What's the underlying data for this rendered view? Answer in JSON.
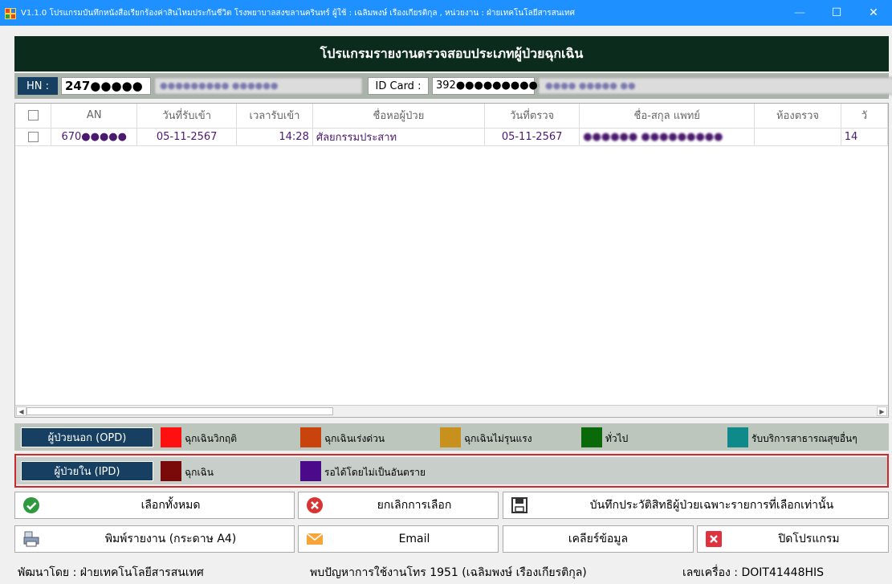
{
  "window": {
    "title": "V1.1.0 โปรแกรมบันทึกหนังสือเรียกร้องค่าสินไหมประกันชีวิต โรงพยาบาลสงขลานครินทร์ ผู้ใช้ : เฉลิมพงษ์ เรืองเกียรติกุล , หน่วยงาน : ฝ่ายเทคโนโลยีสารสนเทศ",
    "minimize": "—",
    "maximize": "☐",
    "close": "✕"
  },
  "header": {
    "title": "โปรแกรมรายงานตรวจสอบประเภทผู้ป่วยฉุกเฉิน"
  },
  "patient": {
    "hn_label": "HN :",
    "hn_value": "247●●●●●",
    "name": "●●●●●●●●● ●●●●●●",
    "idcard_label": "ID Card :",
    "idcard_value": "392●●●●●●●●●●",
    "idcard_name": "●●●● ●●●●● ●●"
  },
  "grid": {
    "columns": [
      "AN",
      "วันที่รับเข้า",
      "เวลารับเข้า",
      "ชื่อหอผู้ป่วย",
      "วันที่ตรวจ",
      "ชื่อ-สกุล แพทย์",
      "ห้องตรวจ",
      "วั"
    ],
    "rows": [
      {
        "an": "670●●●●●",
        "admit_date": "05-11-2567",
        "admit_time": "14:28",
        "ward": "ศัลยกรรมประสาท",
        "exam_date": "05-11-2567",
        "doctor": "●●●●●● ●●●●●●●●●",
        "room": "",
        "extra": "14"
      }
    ]
  },
  "legend": {
    "opd_label": "ผู้ป่วยนอก (OPD)",
    "ipd_label": "ผู้ป่วยใน (IPD)",
    "opd_items": [
      {
        "label": "ฉุกเฉินวิกฤติ",
        "color": "#ff1010"
      },
      {
        "label": "ฉุกเฉินเร่งด่วน",
        "color": "#c8440c"
      },
      {
        "label": "ฉุกเฉินไม่รุนแรง",
        "color": "#c8901c"
      },
      {
        "label": "ทั่วไป",
        "color": "#0a6a0a"
      },
      {
        "label": "รับบริการสาธารณสุขอื่นๆ",
        "color": "#0f8a8a"
      }
    ],
    "ipd_items": [
      {
        "label": "ฉุกเฉิน",
        "color": "#7a0a0a"
      },
      {
        "label": "รอได้โดยไม่เป็นอันตราย",
        "color": "#4a0a8a"
      }
    ]
  },
  "actions": {
    "select_all": "เลือกทั้งหมด",
    "cancel_select": "ยกเลิกการเลือก",
    "save_selected": "บันทึกประวัติสิทธิผู้ป่วยเฉพาะรายการที่เลือกเท่านั้น",
    "print": "พิมพ์รายงาน (กระดาษ A4)",
    "email": "Email",
    "clear": "เคลียร์ข้อมูล",
    "close": "ปิดโปรแกรม"
  },
  "status": {
    "developer": "พัฒนาโดย : ฝ่ายเทคโนโลยีสารสนเทศ",
    "contact": "พบปัญหาการใช้งานโทร 1951 (เฉลิมพงษ์ เรืองเกียรติกุล)",
    "machine": "เลขเครื่อง : DOIT41448HIS"
  }
}
